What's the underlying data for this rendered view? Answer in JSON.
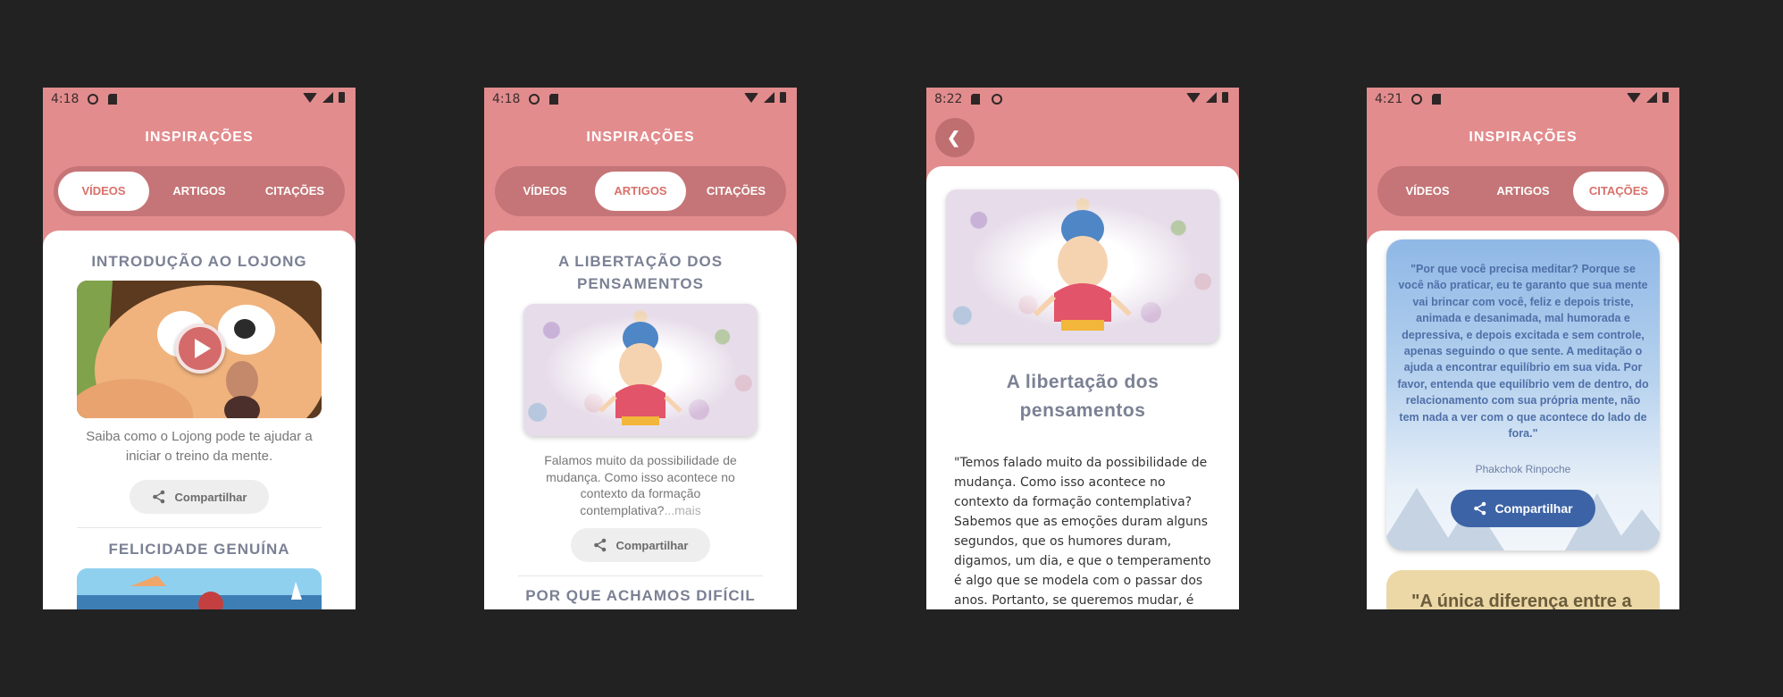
{
  "screens": [
    {
      "status_time": "4:18",
      "title": "INSPIRAÇÕES",
      "tabs": [
        "VÍDEOS",
        "ARTIGOS",
        "CITAÇÕES"
      ],
      "active_tab": "VÍDEOS",
      "item1_title": "INTRODUÇÃO AO LOJONG",
      "item1_desc": "Saiba como o Lojong pode te ajudar a iniciar o treino da mente.",
      "share_label": "Compartilhar",
      "item2_title": "FELICIDADE GENUÍNA",
      "icons": [
        "play-icon",
        "share-icon"
      ]
    },
    {
      "status_time": "4:18",
      "title": "INSPIRAÇÕES",
      "tabs": [
        "VÍDEOS",
        "ARTIGOS",
        "CITAÇÕES"
      ],
      "active_tab": "ARTIGOS",
      "item1_title": "A LIBERTAÇÃO DOS PENSAMENTOS",
      "item1_desc": "Falamos muito da possibilidade de mudança. Como isso acontece no contexto da formação contemplativa?",
      "more_label": "...mais",
      "share_label": "Compartilhar",
      "item2_title": "POR QUE ACHAMOS DIFÍCIL"
    },
    {
      "status_time": "8:22",
      "article_title": "A libertação dos pensamentos",
      "article_text": "\"Temos falado muito da possibilidade de mudança. Como isso acontece no contexto da formação contemplativa? Sabemos que as emoções duram alguns segundos, que os humores duram, digamos, um dia, e que o temperamento é algo que se modela com o passar dos anos. Portanto, se queremos mudar, é"
    },
    {
      "status_time": "4:21",
      "title": "INSPIRAÇÕES",
      "tabs": [
        "VÍDEOS",
        "ARTIGOS",
        "CITAÇÕES"
      ],
      "active_tab": "CITAÇÕES",
      "quote_text": "\"Por que você precisa meditar? Porque se você não praticar, eu te garanto que sua mente vai brincar com você, feliz e depois triste, animada e desanimada, mal humorada e depressiva, e depois excitada e sem controle, apenas seguindo o que sente. A meditação o ajuda a encontrar equilíbrio em sua vida. Por favor, entenda que equilíbrio vem de dentro, do relacionamento com sua própria mente, não tem nada a ver com o que acontece do lado de fora.\"",
      "quote_author": "Phakchok Rinpoche",
      "share_label": "Compartilhar",
      "quote2_start": "\"A única diferença entre a"
    }
  ],
  "colors": {
    "background": "#222222",
    "header_pink": "#e28c8e",
    "tab_bar": "#c57577",
    "active_tab_text": "#d9706a",
    "share_blue": "#3c63a6"
  }
}
